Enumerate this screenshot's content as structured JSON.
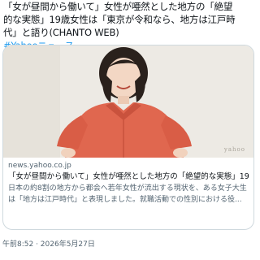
{
  "tweet": {
    "lines": [
      "「女が昼間から働いて」女性が唖然とした地方の「絶望",
      "的な実態」19歳女性は「東京が令和なら、地方は江戸時",
      "代」と語り(CHANTO WEB)"
    ],
    "hashtag": "#Yahooニュース"
  },
  "card": {
    "watermark": "yahoo",
    "domain": "news.yahoo.co.jp",
    "title": "「女が昼間から働いて」女性が唖然とした地方の「絶望的な実態」19...",
    "description": [
      "日本の約8割の地方から都会へ若年女性が流出する現状を、ある女子大生",
      "は「地方は江戸時代」と表現しました。就職活動での性別における役..."
    ]
  },
  "meta": {
    "timestamp": "午前8:52 · 2026年5月27日"
  },
  "colors": {
    "link": "#1d9bf0",
    "text": "#0f1419",
    "secondary": "#536471",
    "dress": "#e0674f"
  }
}
